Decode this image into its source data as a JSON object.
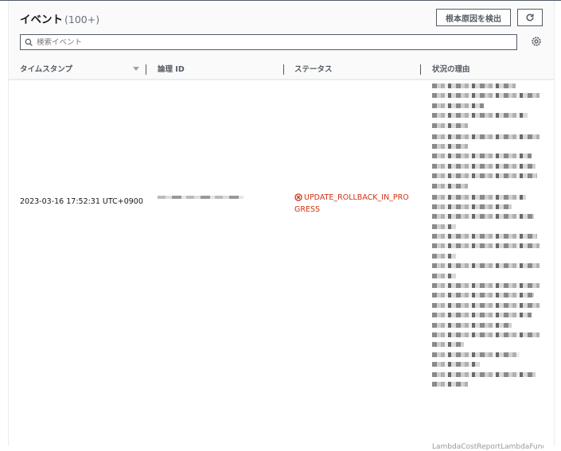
{
  "header": {
    "title": "イベント",
    "count": "(100+)",
    "root_cause_button": "根本原因を検出",
    "refresh_button_icon": "refresh-icon",
    "settings_icon": "gear-icon"
  },
  "search": {
    "placeholder": "検索イベント",
    "value": ""
  },
  "table": {
    "columns": [
      "タイムスタンプ",
      "論理 ID",
      "ステータス",
      "状況の理由"
    ],
    "sort_column": "タイムスタンプ",
    "sort_direction": "descending",
    "rows": [
      {
        "timestamp": "2023-03-16 17:52:31 UTC+0900",
        "logical_id": "[redacted]",
        "status": "UPDATE_ROLLBACK_IN_PROGRESS",
        "status_icon": "error-circle-icon",
        "reason": "[redacted]",
        "reason_tail": "LambdaCostReportLambdaFunc"
      }
    ]
  },
  "colors": {
    "error": "#d13212",
    "text": "#16191f",
    "secondary": "#545b64",
    "border": "#eaeded"
  }
}
